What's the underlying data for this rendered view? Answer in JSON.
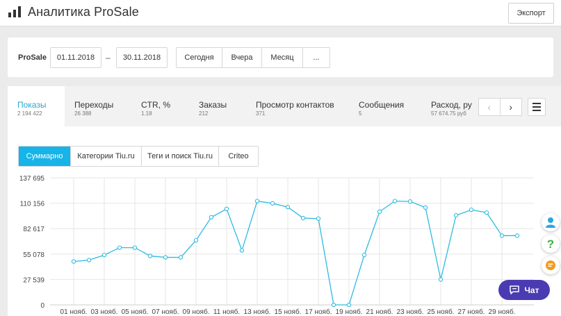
{
  "header": {
    "title": "Аналитика ProSale",
    "export_label": "Экспорт"
  },
  "filters": {
    "label": "ProSale",
    "date_from": "01.11.2018",
    "separator": "–",
    "date_to": "30.11.2018",
    "periods": [
      "Сегодня",
      "Вчера",
      "Месяц",
      "..."
    ]
  },
  "metrics": [
    {
      "label": "Показы",
      "value": "2 194 422",
      "active": true
    },
    {
      "label": "Переходы",
      "value": "26 388"
    },
    {
      "label": "CTR, %",
      "value": "1.18"
    },
    {
      "label": "Заказы",
      "value": "212"
    },
    {
      "label": "Просмотр контактов",
      "value": "371"
    },
    {
      "label": "Сообщения",
      "value": "5"
    },
    {
      "label": "Расход, ру",
      "value": "57 674.75 руб"
    }
  ],
  "nav": {
    "prev": "‹",
    "next": "›"
  },
  "chart_tabs": [
    "Суммарно",
    "Категории Tiu.ru",
    "Теги и поиск Tiu.ru",
    "Criteo"
  ],
  "chat_label": "Чат",
  "colors": {
    "accent": "#16b4e8",
    "line": "#2dbbe0",
    "chat": "#4b3bb2"
  },
  "chart_data": {
    "type": "line",
    "series": [
      {
        "values": [
          47000,
          48500,
          54000,
          62000,
          62000,
          53000,
          51500,
          51500,
          70000,
          95000,
          104000,
          59000,
          112500,
          110000,
          106000,
          94000,
          93500,
          0,
          0,
          54000,
          101000,
          112500,
          112000,
          105500,
          27500,
          97000,
          103000,
          100000,
          75000,
          75000
        ]
      }
    ],
    "x": [
      "01 нояб.",
      "02 нояб.",
      "03 нояб.",
      "04 нояб.",
      "05 нояб.",
      "06 нояб.",
      "07 нояб.",
      "08 нояб.",
      "09 нояб.",
      "10 нояб.",
      "11 нояб.",
      "12 нояб.",
      "13 нояб.",
      "14 нояб.",
      "15 нояб.",
      "16 нояб.",
      "17 нояб.",
      "18 нояб.",
      "19 нояб.",
      "20 нояб.",
      "21 нояб.",
      "22 нояб.",
      "23 нояб.",
      "24 нояб.",
      "25 нояб.",
      "26 нояб.",
      "27 нояб.",
      "28 нояб.",
      "29 нояб.",
      "30 нояб."
    ],
    "x_tick_labels": [
      "01 нояб.",
      "03 нояб.",
      "05 нояб.",
      "07 нояб.",
      "09 нояб.",
      "11 нояб.",
      "13 нояб.",
      "15 нояб.",
      "17 нояб.",
      "19 нояб.",
      "21 нояб.",
      "23 нояб.",
      "25 нояб.",
      "27 нояб.",
      "29 нояб."
    ],
    "y_tick_labels": [
      "0",
      "27 539",
      "55 078",
      "82 617",
      "110 156",
      "137 695"
    ],
    "ylim": [
      0,
      137695
    ],
    "grid": true,
    "legend": "none"
  }
}
